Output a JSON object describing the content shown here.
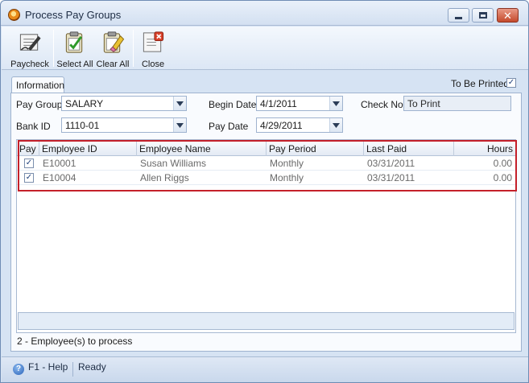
{
  "window": {
    "title": "Process Pay Groups"
  },
  "toolbar": {
    "paycheck": "Paycheck",
    "select_all": "Select All",
    "clear_all": "Clear All",
    "close": "Close"
  },
  "tab": {
    "label": "Information"
  },
  "form": {
    "to_be_printed_label": "To Be Printed",
    "to_be_printed_checked": true,
    "pay_group_label": "Pay Group",
    "pay_group_value": "SALARY",
    "begin_date_label": "Begin Date",
    "begin_date_value": "4/1/2011",
    "check_no_label": "Check No",
    "check_no_value": "To Print",
    "bank_id_label": "Bank ID",
    "bank_id_value": "1110-01",
    "pay_date_label": "Pay Date",
    "pay_date_value": "4/29/2011"
  },
  "grid": {
    "columns": [
      "Pay",
      "Employee ID",
      "Employee Name",
      "Pay Period",
      "Last Paid",
      "Hours"
    ],
    "rows": [
      {
        "pay": true,
        "employee_id": "E10001",
        "employee_name": "Susan Williams",
        "pay_period": "Monthly",
        "last_paid": "03/31/2011",
        "hours": "0.00"
      },
      {
        "pay": true,
        "employee_id": "E10004",
        "employee_name": "Allen Riggs",
        "pay_period": "Monthly",
        "last_paid": "03/31/2011",
        "hours": "0.00"
      }
    ]
  },
  "summary": {
    "process_count": "2 -  Employee(s) to process"
  },
  "status": {
    "help": "F1 - Help",
    "state": "Ready"
  },
  "colors": {
    "highlight": "#c4202a",
    "accent": "#2a62b8"
  }
}
